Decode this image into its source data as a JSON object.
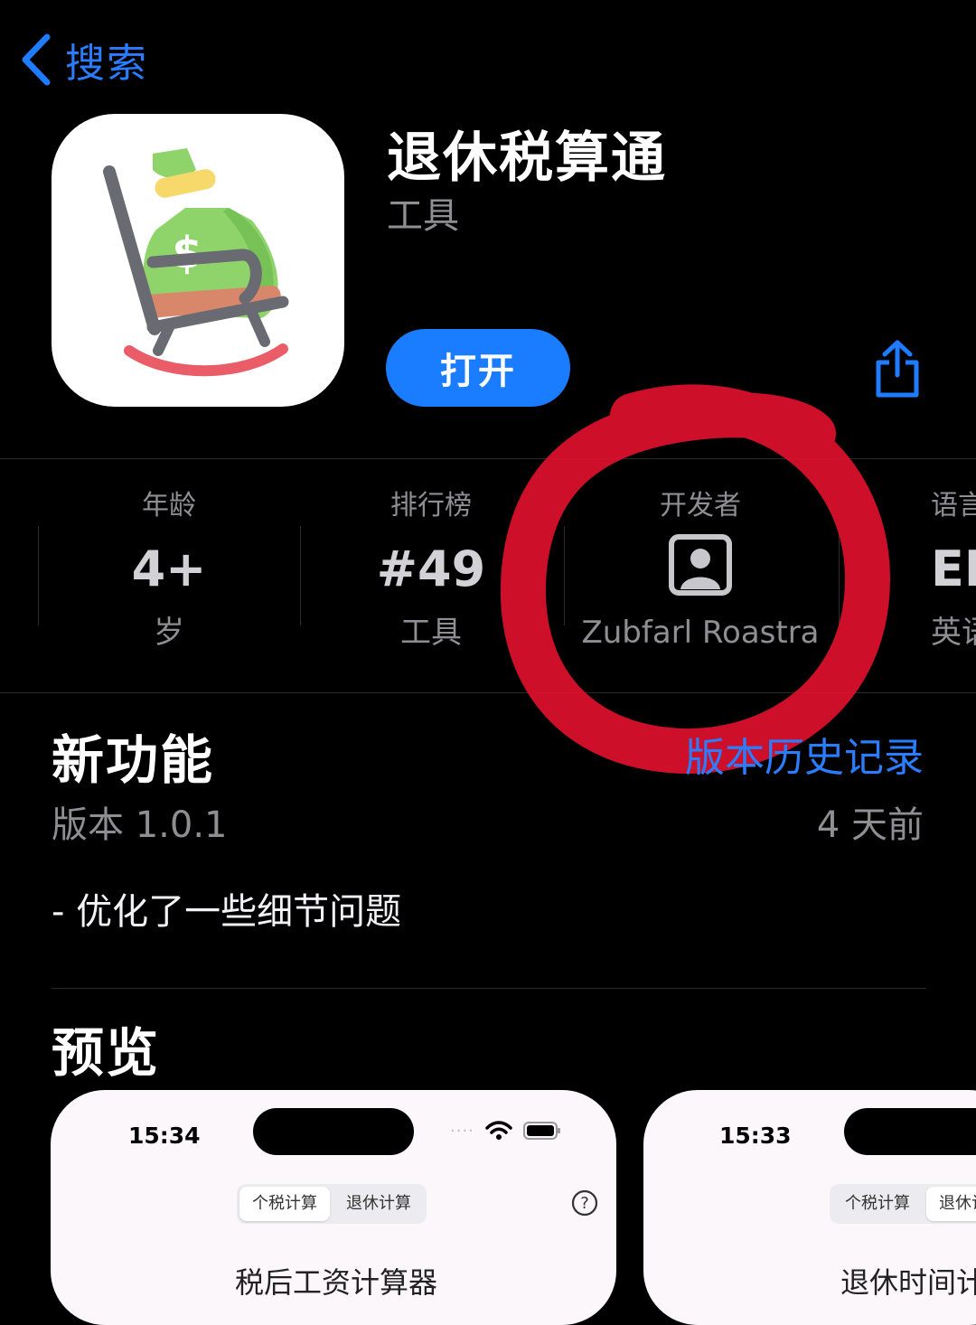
{
  "nav": {
    "back_label": "搜索"
  },
  "app": {
    "title": "退休税算通",
    "category": "工具",
    "open_label": "打开"
  },
  "info": {
    "age": {
      "label": "年龄",
      "value": "4+",
      "sub": "岁"
    },
    "rank": {
      "label": "排行榜",
      "value": "#49",
      "sub": "工具"
    },
    "developer": {
      "label": "开发者",
      "sub": "Zubfarl Roastra"
    },
    "language": {
      "label": "语言",
      "value": "EN",
      "sub": "英语"
    }
  },
  "whats_new": {
    "title": "新功能",
    "history_link": "版本历史记录",
    "version": "版本 1.0.1",
    "ago": "4 天前",
    "notes": "- 优化了一些细节问题"
  },
  "preview": {
    "title": "预览",
    "cards": [
      {
        "time": "15:34",
        "seg_a": "个税计算",
        "seg_b": "退休计算",
        "heading": "税后工资计算器"
      },
      {
        "time": "15:33",
        "seg_a": "个税计算",
        "seg_b": "退休计算",
        "heading": "退休时间计算"
      }
    ]
  },
  "colors": {
    "accent": "#1a7cff",
    "annotation": "#e0102e"
  }
}
